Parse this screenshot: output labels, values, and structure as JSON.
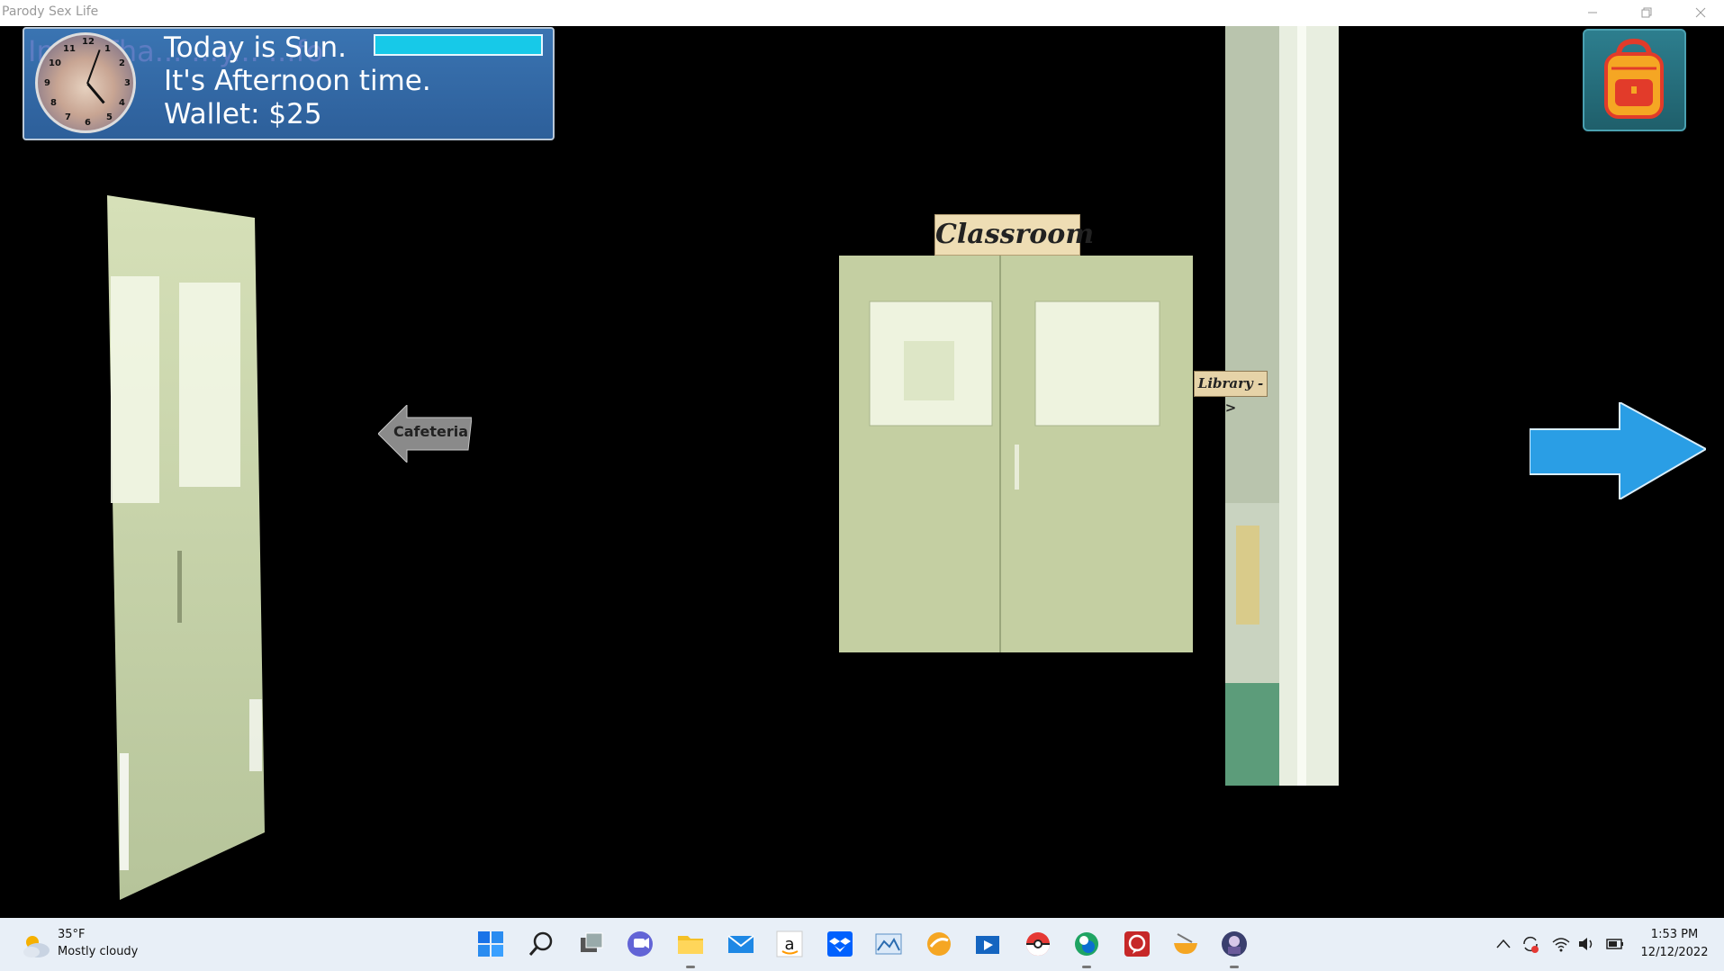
{
  "window": {
    "title": "Parody Sex Life"
  },
  "hud": {
    "ghost_text": "Im... Tha... ...y... ...fo",
    "day_text": "Today is Sun.",
    "time_text": "It's Afternoon time.",
    "wallet_text": "Wallet: $25",
    "energy_level": 1.0,
    "energy_color": "#17c9e8"
  },
  "scene": {
    "classroom_sign": "Classroom",
    "library_sign": "Library ->",
    "cafeteria_label": "Cafeteria"
  },
  "taskbar": {
    "weather_temp": "35°F",
    "weather_condition": "Mostly cloudy",
    "time": "1:53 PM",
    "date": "12/12/2022",
    "pinned_icons": [
      "start-icon",
      "search-icon",
      "task-view-icon",
      "chat-icon",
      "file-explorer-icon",
      "mail-icon",
      "amazon-icon",
      "dropbox-icon",
      "photos-icon",
      "orange-app-icon",
      "movies-icon",
      "pokeball-icon",
      "edge-icon",
      "chat-bubble-icon",
      "ramen-icon",
      "game-icon"
    ]
  },
  "colors": {
    "hud_blue": "#2d5f9a",
    "next_arrow": "#2a9ee5",
    "backpack_orange": "#f5a623"
  }
}
